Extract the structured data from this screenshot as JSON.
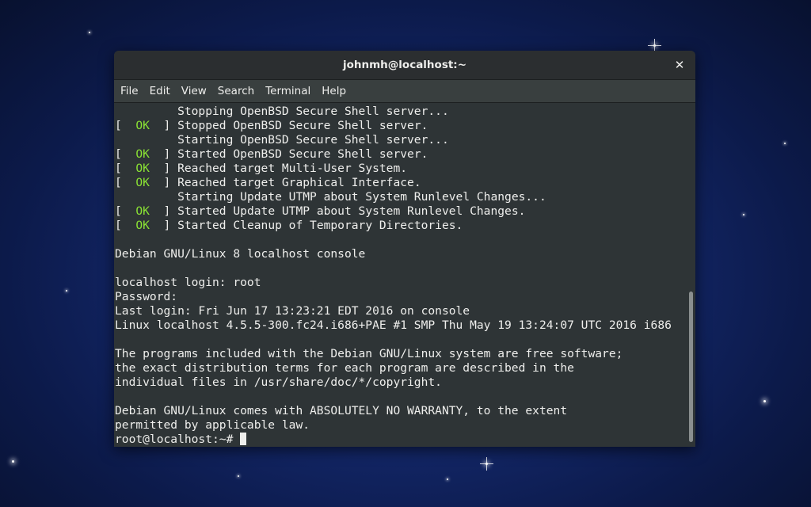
{
  "window": {
    "title": "johnmh@localhost:~",
    "close_glyph": "✕"
  },
  "menubar": {
    "items": [
      {
        "label": "File"
      },
      {
        "label": "Edit"
      },
      {
        "label": "View"
      },
      {
        "label": "Search"
      },
      {
        "label": "Terminal"
      },
      {
        "label": "Help"
      }
    ]
  },
  "terminal": {
    "colors": {
      "background": "#2e3436",
      "foreground": "#eeeeec",
      "ok": "#8ae234"
    },
    "lines": [
      {
        "prefix": "         ",
        "ok": "",
        "suffix": "",
        "text": "Stopping OpenBSD Secure Shell server..."
      },
      {
        "prefix": "[  ",
        "ok": "OK",
        "suffix": "  ] ",
        "text": "Stopped OpenBSD Secure Shell server."
      },
      {
        "prefix": "         ",
        "ok": "",
        "suffix": "",
        "text": "Starting OpenBSD Secure Shell server..."
      },
      {
        "prefix": "[  ",
        "ok": "OK",
        "suffix": "  ] ",
        "text": "Started OpenBSD Secure Shell server."
      },
      {
        "prefix": "[  ",
        "ok": "OK",
        "suffix": "  ] ",
        "text": "Reached target Multi-User System."
      },
      {
        "prefix": "[  ",
        "ok": "OK",
        "suffix": "  ] ",
        "text": "Reached target Graphical Interface."
      },
      {
        "prefix": "         ",
        "ok": "",
        "suffix": "",
        "text": "Starting Update UTMP about System Runlevel Changes..."
      },
      {
        "prefix": "[  ",
        "ok": "OK",
        "suffix": "  ] ",
        "text": "Started Update UTMP about System Runlevel Changes."
      },
      {
        "prefix": "[  ",
        "ok": "OK",
        "suffix": "  ] ",
        "text": "Started Cleanup of Temporary Directories."
      },
      {
        "prefix": "",
        "ok": "",
        "suffix": "",
        "text": ""
      },
      {
        "prefix": "",
        "ok": "",
        "suffix": "",
        "text": "Debian GNU/Linux 8 localhost console"
      },
      {
        "prefix": "",
        "ok": "",
        "suffix": "",
        "text": ""
      },
      {
        "prefix": "",
        "ok": "",
        "suffix": "",
        "text": "localhost login: root"
      },
      {
        "prefix": "",
        "ok": "",
        "suffix": "",
        "text": "Password:"
      },
      {
        "prefix": "",
        "ok": "",
        "suffix": "",
        "text": "Last login: Fri Jun 17 13:23:21 EDT 2016 on console"
      },
      {
        "prefix": "",
        "ok": "",
        "suffix": "",
        "text": "Linux localhost 4.5.5-300.fc24.i686+PAE #1 SMP Thu May 19 13:24:07 UTC 2016 i686"
      },
      {
        "prefix": "",
        "ok": "",
        "suffix": "",
        "text": ""
      },
      {
        "prefix": "",
        "ok": "",
        "suffix": "",
        "text": "The programs included with the Debian GNU/Linux system are free software;"
      },
      {
        "prefix": "",
        "ok": "",
        "suffix": "",
        "text": "the exact distribution terms for each program are described in the"
      },
      {
        "prefix": "",
        "ok": "",
        "suffix": "",
        "text": "individual files in /usr/share/doc/*/copyright."
      },
      {
        "prefix": "",
        "ok": "",
        "suffix": "",
        "text": ""
      },
      {
        "prefix": "",
        "ok": "",
        "suffix": "",
        "text": "Debian GNU/Linux comes with ABSOLUTELY NO WARRANTY, to the extent"
      },
      {
        "prefix": "",
        "ok": "",
        "suffix": "",
        "text": "permitted by applicable law."
      }
    ],
    "prompt": "root@localhost:~# "
  }
}
